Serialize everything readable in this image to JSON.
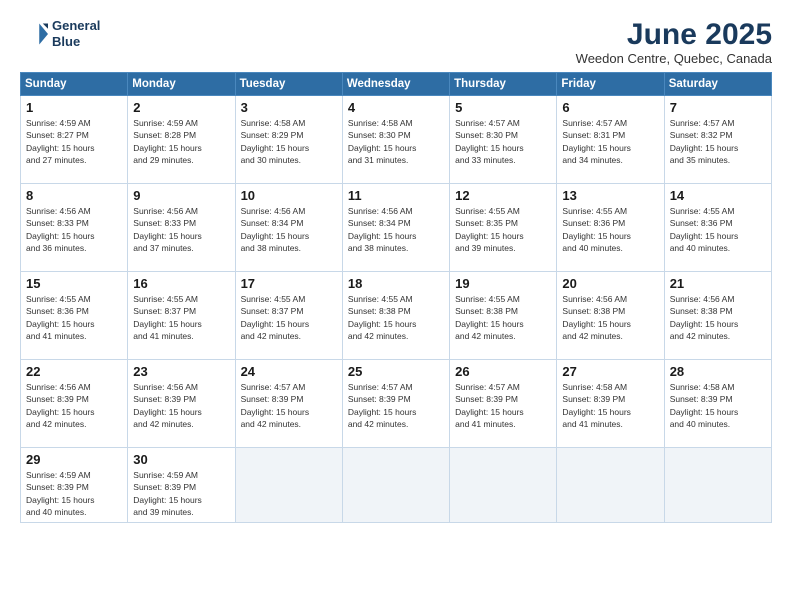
{
  "header": {
    "logo_line1": "General",
    "logo_line2": "Blue",
    "month_title": "June 2025",
    "location": "Weedon Centre, Quebec, Canada"
  },
  "weekdays": [
    "Sunday",
    "Monday",
    "Tuesday",
    "Wednesday",
    "Thursday",
    "Friday",
    "Saturday"
  ],
  "weeks": [
    [
      {
        "day": 1,
        "info": "Sunrise: 4:59 AM\nSunset: 8:27 PM\nDaylight: 15 hours\nand 27 minutes."
      },
      {
        "day": 2,
        "info": "Sunrise: 4:59 AM\nSunset: 8:28 PM\nDaylight: 15 hours\nand 29 minutes."
      },
      {
        "day": 3,
        "info": "Sunrise: 4:58 AM\nSunset: 8:29 PM\nDaylight: 15 hours\nand 30 minutes."
      },
      {
        "day": 4,
        "info": "Sunrise: 4:58 AM\nSunset: 8:30 PM\nDaylight: 15 hours\nand 31 minutes."
      },
      {
        "day": 5,
        "info": "Sunrise: 4:57 AM\nSunset: 8:30 PM\nDaylight: 15 hours\nand 33 minutes."
      },
      {
        "day": 6,
        "info": "Sunrise: 4:57 AM\nSunset: 8:31 PM\nDaylight: 15 hours\nand 34 minutes."
      },
      {
        "day": 7,
        "info": "Sunrise: 4:57 AM\nSunset: 8:32 PM\nDaylight: 15 hours\nand 35 minutes."
      }
    ],
    [
      {
        "day": 8,
        "info": "Sunrise: 4:56 AM\nSunset: 8:33 PM\nDaylight: 15 hours\nand 36 minutes."
      },
      {
        "day": 9,
        "info": "Sunrise: 4:56 AM\nSunset: 8:33 PM\nDaylight: 15 hours\nand 37 minutes."
      },
      {
        "day": 10,
        "info": "Sunrise: 4:56 AM\nSunset: 8:34 PM\nDaylight: 15 hours\nand 38 minutes."
      },
      {
        "day": 11,
        "info": "Sunrise: 4:56 AM\nSunset: 8:34 PM\nDaylight: 15 hours\nand 38 minutes."
      },
      {
        "day": 12,
        "info": "Sunrise: 4:55 AM\nSunset: 8:35 PM\nDaylight: 15 hours\nand 39 minutes."
      },
      {
        "day": 13,
        "info": "Sunrise: 4:55 AM\nSunset: 8:36 PM\nDaylight: 15 hours\nand 40 minutes."
      },
      {
        "day": 14,
        "info": "Sunrise: 4:55 AM\nSunset: 8:36 PM\nDaylight: 15 hours\nand 40 minutes."
      }
    ],
    [
      {
        "day": 15,
        "info": "Sunrise: 4:55 AM\nSunset: 8:36 PM\nDaylight: 15 hours\nand 41 minutes."
      },
      {
        "day": 16,
        "info": "Sunrise: 4:55 AM\nSunset: 8:37 PM\nDaylight: 15 hours\nand 41 minutes."
      },
      {
        "day": 17,
        "info": "Sunrise: 4:55 AM\nSunset: 8:37 PM\nDaylight: 15 hours\nand 42 minutes."
      },
      {
        "day": 18,
        "info": "Sunrise: 4:55 AM\nSunset: 8:38 PM\nDaylight: 15 hours\nand 42 minutes."
      },
      {
        "day": 19,
        "info": "Sunrise: 4:55 AM\nSunset: 8:38 PM\nDaylight: 15 hours\nand 42 minutes."
      },
      {
        "day": 20,
        "info": "Sunrise: 4:56 AM\nSunset: 8:38 PM\nDaylight: 15 hours\nand 42 minutes."
      },
      {
        "day": 21,
        "info": "Sunrise: 4:56 AM\nSunset: 8:38 PM\nDaylight: 15 hours\nand 42 minutes."
      }
    ],
    [
      {
        "day": 22,
        "info": "Sunrise: 4:56 AM\nSunset: 8:39 PM\nDaylight: 15 hours\nand 42 minutes."
      },
      {
        "day": 23,
        "info": "Sunrise: 4:56 AM\nSunset: 8:39 PM\nDaylight: 15 hours\nand 42 minutes."
      },
      {
        "day": 24,
        "info": "Sunrise: 4:57 AM\nSunset: 8:39 PM\nDaylight: 15 hours\nand 42 minutes."
      },
      {
        "day": 25,
        "info": "Sunrise: 4:57 AM\nSunset: 8:39 PM\nDaylight: 15 hours\nand 42 minutes."
      },
      {
        "day": 26,
        "info": "Sunrise: 4:57 AM\nSunset: 8:39 PM\nDaylight: 15 hours\nand 41 minutes."
      },
      {
        "day": 27,
        "info": "Sunrise: 4:58 AM\nSunset: 8:39 PM\nDaylight: 15 hours\nand 41 minutes."
      },
      {
        "day": 28,
        "info": "Sunrise: 4:58 AM\nSunset: 8:39 PM\nDaylight: 15 hours\nand 40 minutes."
      }
    ],
    [
      {
        "day": 29,
        "info": "Sunrise: 4:59 AM\nSunset: 8:39 PM\nDaylight: 15 hours\nand 40 minutes."
      },
      {
        "day": 30,
        "info": "Sunrise: 4:59 AM\nSunset: 8:39 PM\nDaylight: 15 hours\nand 39 minutes."
      },
      null,
      null,
      null,
      null,
      null
    ]
  ]
}
